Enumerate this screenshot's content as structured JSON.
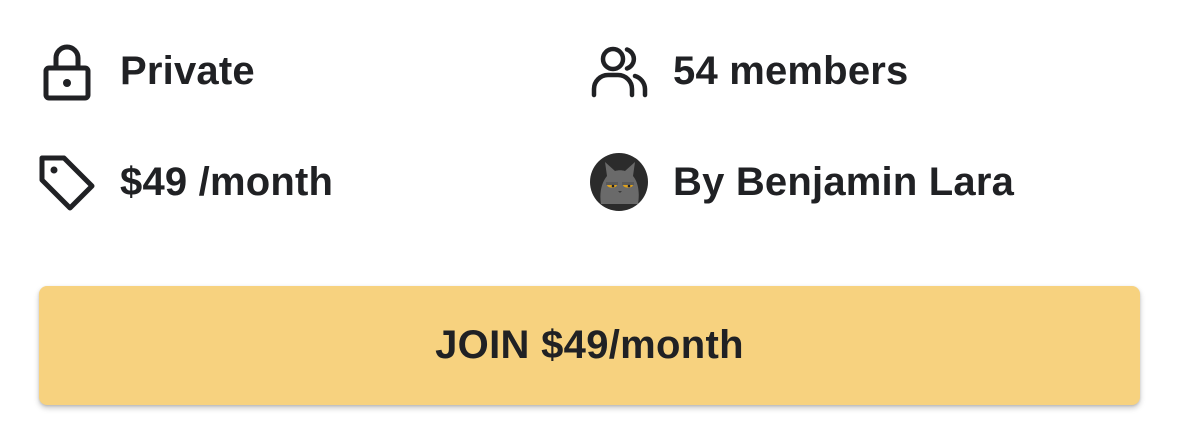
{
  "group_info": {
    "privacy": {
      "icon": "lock-icon",
      "label": "Private"
    },
    "members": {
      "icon": "users-icon",
      "label": "54 members"
    },
    "price": {
      "icon": "tag-icon",
      "label": "$49 /month"
    },
    "owner": {
      "icon": "cat-avatar",
      "label": "By Benjamin Lara"
    }
  },
  "join_button": {
    "label": "JOIN $49/month"
  },
  "colors": {
    "button_bg": "#f7d27f",
    "text": "#202124",
    "avatar_bg": "#2b2b2b"
  }
}
